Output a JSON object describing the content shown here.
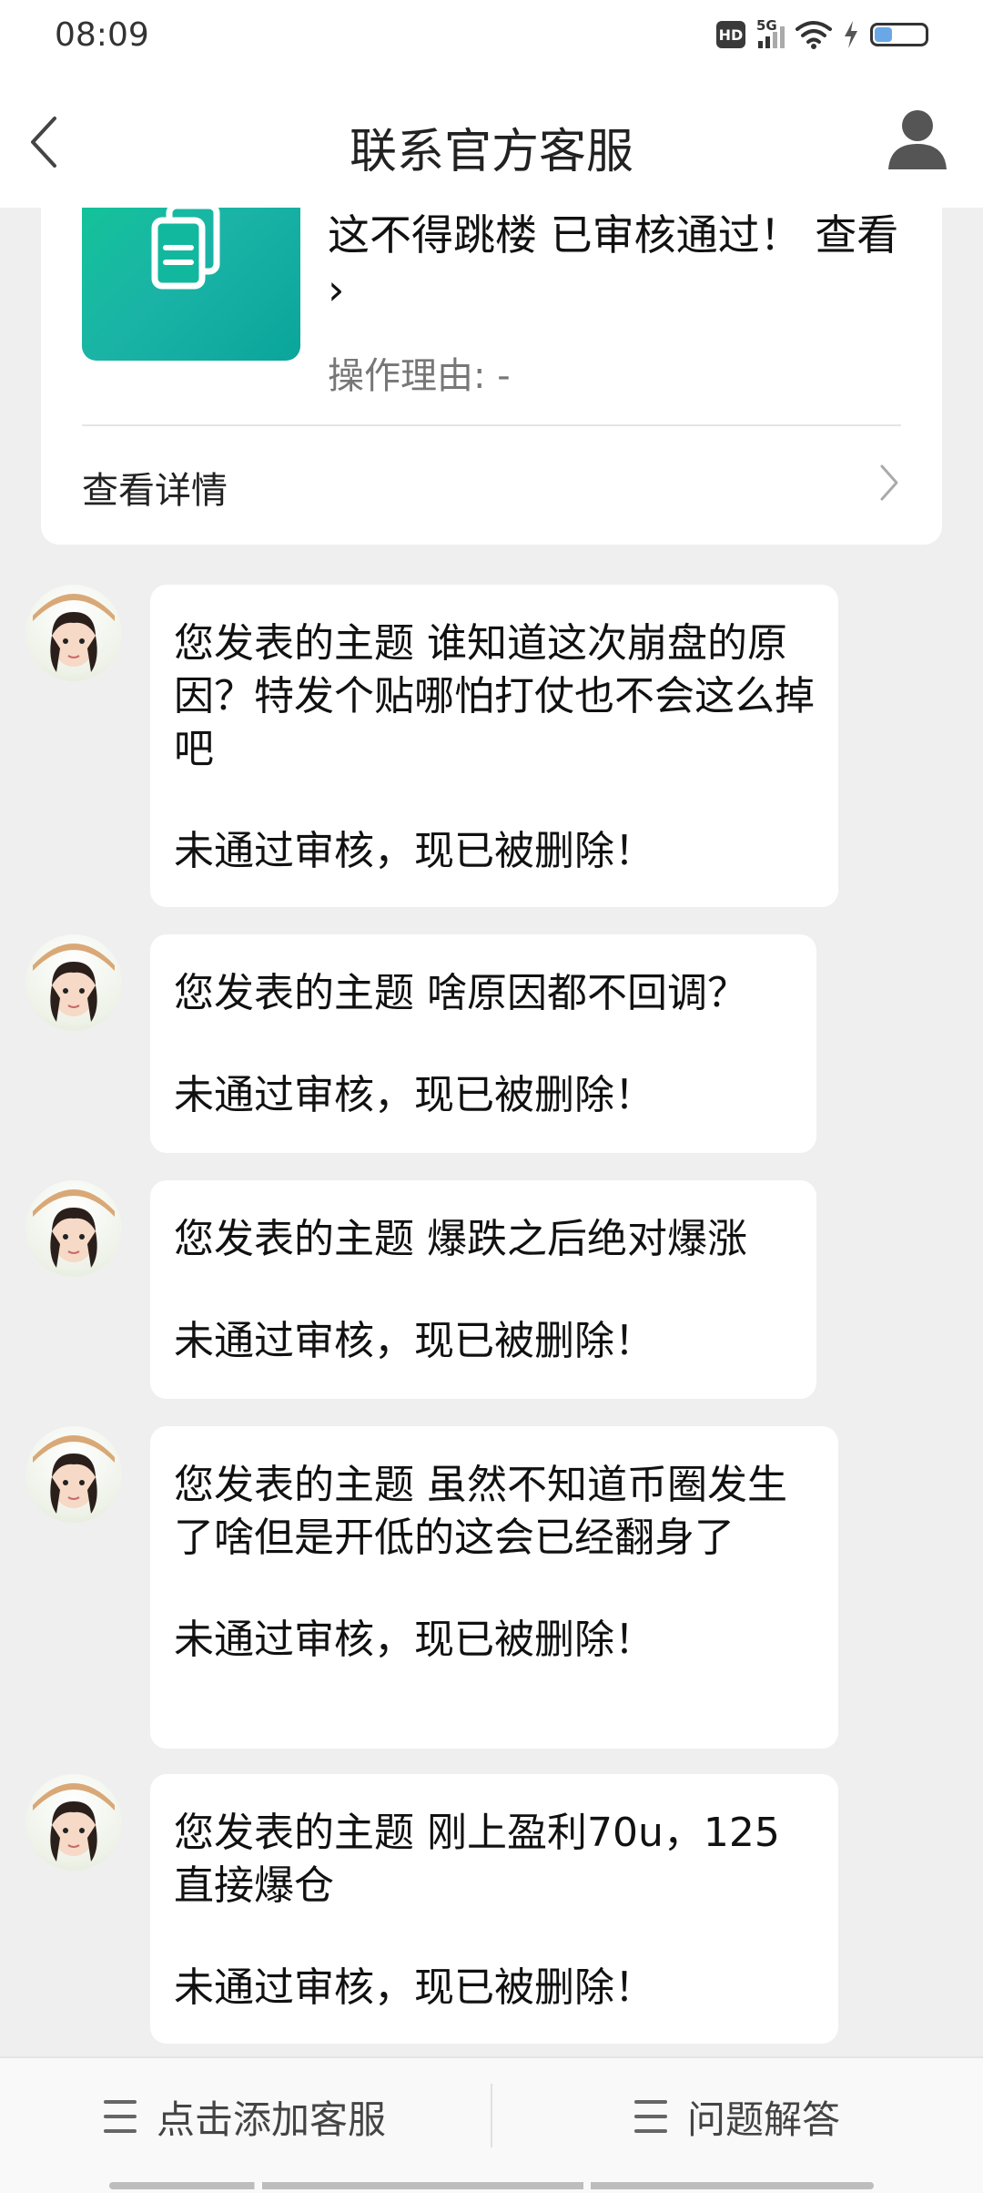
{
  "status_bar": {
    "time": "08:09",
    "hd_label": "HD",
    "network_label": "5G"
  },
  "header": {
    "title": "联系官方客服",
    "back_icon": "chevron-left-icon",
    "profile_icon": "user-icon"
  },
  "card": {
    "text": "这不得跳楼 已审核通过！  查看 ›",
    "reason": "操作理由: -",
    "detail_label": "查看详情",
    "thumb_icon": "document-icon",
    "thumb_color": "#14c29a"
  },
  "messages": [
    {
      "topic": "您发表的主题 谁知道这次崩盘的原因？特发个贴哪怕打仗也不会这么掉吧",
      "status": "未通过审核，现已被删除！"
    },
    {
      "topic": "您发表的主题 啥原因都不回调？",
      "status": "未通过审核，现已被删除！"
    },
    {
      "topic": "您发表的主题 爆跌之后绝对爆涨",
      "status": "未通过审核，现已被删除！"
    },
    {
      "topic": "您发表的主题 虽然不知道币圈发生了啥但是开低的这会已经翻身了",
      "status": "未通过审核，现已被删除！"
    },
    {
      "topic": "您发表的主题 刚上盈利70u，125直接爆仓",
      "status": "未通过审核，现已被删除！"
    }
  ],
  "bottom_bar": {
    "add_service_label": "点击添加客服",
    "faq_label": "问题解答",
    "menu_icon": "menu-icon"
  }
}
